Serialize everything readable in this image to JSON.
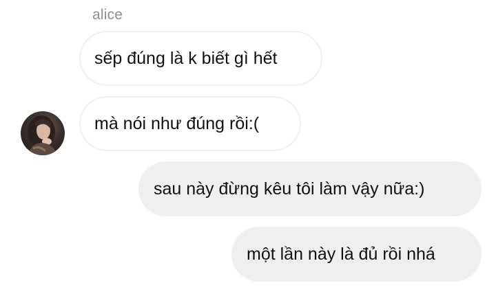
{
  "conversation": {
    "sender_name": "alice",
    "messages": [
      {
        "direction": "incoming",
        "text": "sếp đúng là k biết gì hết"
      },
      {
        "direction": "incoming",
        "text": "mà nói như đúng rồi:("
      },
      {
        "direction": "outgoing",
        "text": "sau này đừng kêu tôi làm vậy nữa:)"
      },
      {
        "direction": "outgoing",
        "text": "một lần này là đủ rồi nhá"
      }
    ]
  },
  "colors": {
    "background": "#ffffff",
    "incoming_bubble_border": "#efefef",
    "outgoing_bubble_fill": "#efefef",
    "sender_name": "#8e8e8e",
    "text": "#111111"
  }
}
